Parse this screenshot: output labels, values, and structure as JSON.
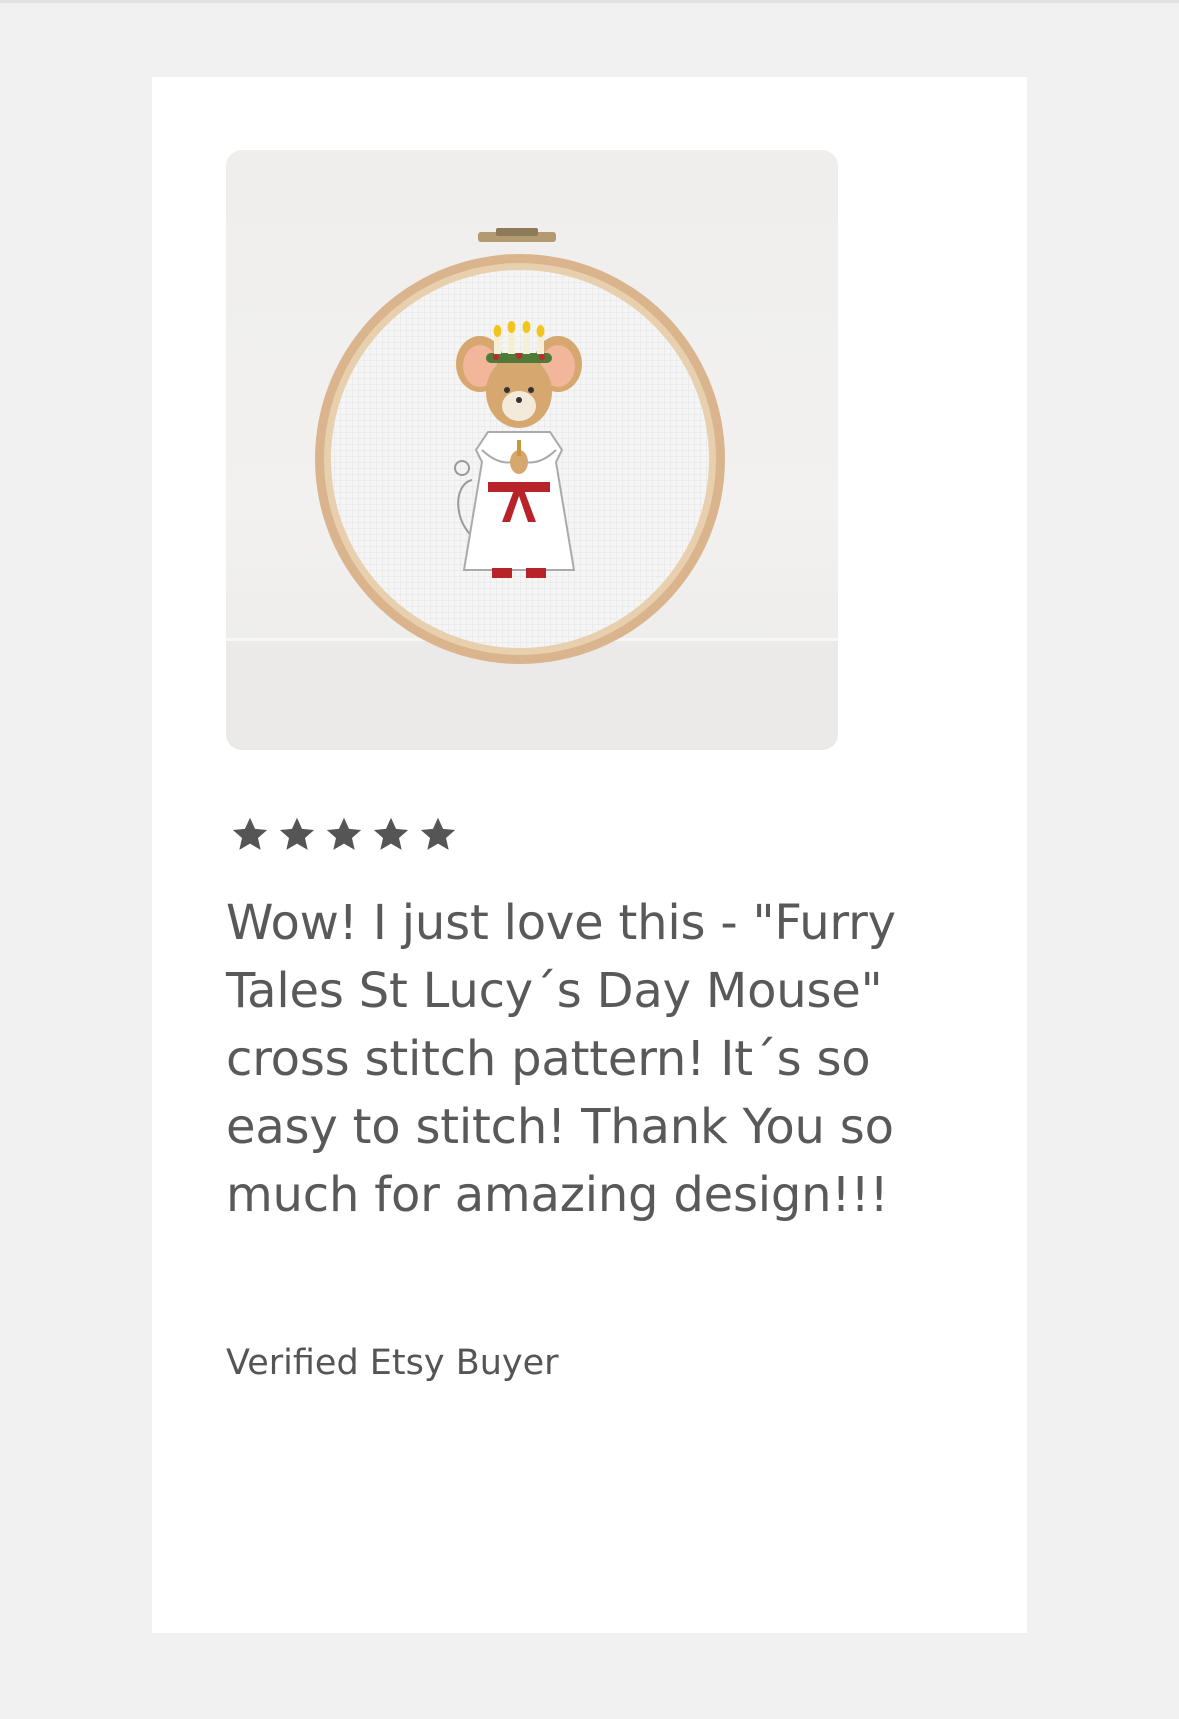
{
  "review": {
    "image": {
      "alt": "Furry Tales St Lucy's Day Mouse cross stitch in embroidery hoop",
      "colors": {
        "hoop": "#d9b48c",
        "fabric": "#f4f4f4",
        "dress": "#ffffff",
        "sash": "#b8232a",
        "mouse_fur": "#d7a770",
        "ears": "#f2b69a",
        "candles": "#f2c41e"
      }
    },
    "rating": {
      "stars": 5,
      "max": 5,
      "color": "#555555"
    },
    "text": "Wow! I just love this - \"Furry Tales St Lucy´s Day Mouse\" cross stitch pattern! It´s so easy to stitch! Thank You so much for amazing design!!!",
    "author": "Verified Etsy Buyer"
  }
}
